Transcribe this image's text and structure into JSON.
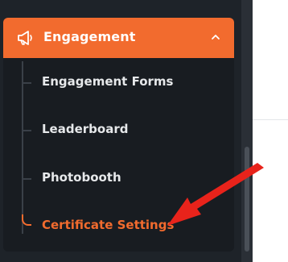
{
  "sidebar": {
    "header": {
      "label": "Engagement",
      "icon": "megaphone-icon",
      "chevron": "chevron-up-icon",
      "background": "#f26b2e"
    },
    "items": [
      {
        "label": "Engagement Forms"
      },
      {
        "label": "Leaderboard"
      },
      {
        "label": "Photobooth"
      },
      {
        "label": "Certificate Settings",
        "active": true
      }
    ]
  },
  "annotation": {
    "type": "arrow",
    "color": "#e8231b",
    "points_to": "Certificate Settings"
  }
}
